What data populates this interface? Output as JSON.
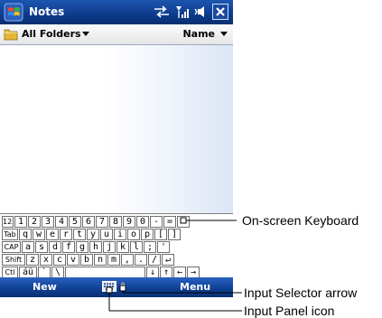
{
  "window": {
    "title": "Notes",
    "close_label": "✕"
  },
  "folderbar": {
    "folder_label": "All Folders",
    "sort_label": "Name"
  },
  "keyboard": {
    "rows": [
      [
        "123",
        "1",
        "2",
        "3",
        "4",
        "5",
        "6",
        "7",
        "8",
        "9",
        "0",
        "-",
        "=",
        "⬅"
      ],
      [
        "Tab",
        "q",
        "w",
        "e",
        "r",
        "t",
        "y",
        "u",
        "i",
        "o",
        "p",
        "[",
        "]"
      ],
      [
        "CAP",
        "a",
        "s",
        "d",
        "f",
        "g",
        "h",
        "j",
        "k",
        "l",
        ";",
        "'"
      ],
      [
        "Shift",
        "z",
        "x",
        "c",
        "v",
        "b",
        "n",
        "m",
        ",",
        ".",
        "/",
        "↵"
      ],
      [
        "Ctl",
        "áü",
        "`",
        "\\",
        "",
        "↓",
        "↑",
        "←",
        "→"
      ]
    ]
  },
  "menubar": {
    "left_label": "New",
    "right_label": "Menu"
  },
  "callouts": {
    "keyboard": "On-screen Keyboard",
    "selector": "Input Selector arrow",
    "panel": "Input Panel icon"
  },
  "icons": {
    "start": "windows-flag-icon",
    "sync": "sync-arrows-icon",
    "signal": "signal-strength-icon",
    "volume": "speaker-icon",
    "folder": "folder-icon",
    "input_panel": "keyboard-icon",
    "selector": "up-arrow-icon"
  },
  "colors": {
    "titlebar": "#0d3b8c",
    "menubar": "#0f3e92"
  }
}
